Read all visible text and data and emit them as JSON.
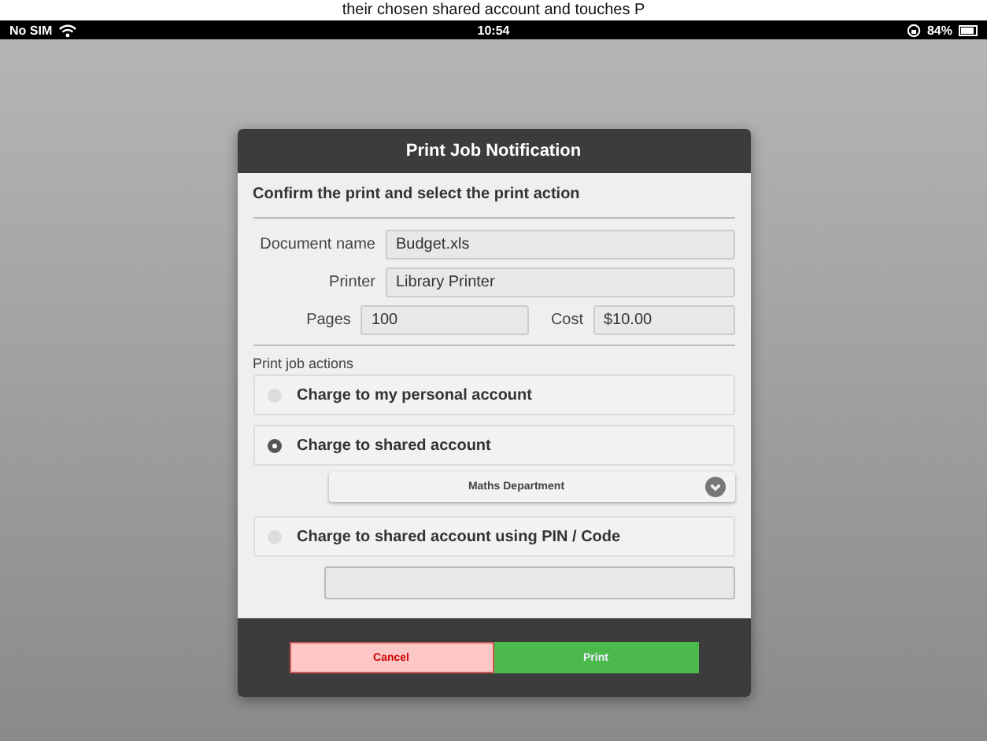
{
  "caption": "their chosen shared account and touches P",
  "status_bar": {
    "carrier": "No SIM",
    "time": "10:54",
    "battery": "84%"
  },
  "dialog": {
    "title": "Print Job Notification",
    "heading": "Confirm the print and select the print action",
    "fields": [
      {
        "label": "Document name",
        "value": "Budget.xls"
      },
      {
        "label": "Printer",
        "value": "Library Printer"
      },
      {
        "label": "Pages",
        "value": "100"
      },
      {
        "label": "Cost",
        "value": "$10.00"
      }
    ],
    "actions_label": "Print job actions",
    "actions": [
      {
        "label": "Charge to my personal account",
        "selected": false,
        "kind": "plain"
      },
      {
        "label": "Charge to shared account",
        "selected": true,
        "kind": "dropdown",
        "value": "Maths Department"
      },
      {
        "label": "Charge to shared account using PIN / Code",
        "selected": false,
        "kind": "code"
      }
    ],
    "buttons": [
      {
        "label": "Cancel",
        "kind": "cancel"
      },
      {
        "label": "Print",
        "kind": "confirm"
      }
    ]
  }
}
